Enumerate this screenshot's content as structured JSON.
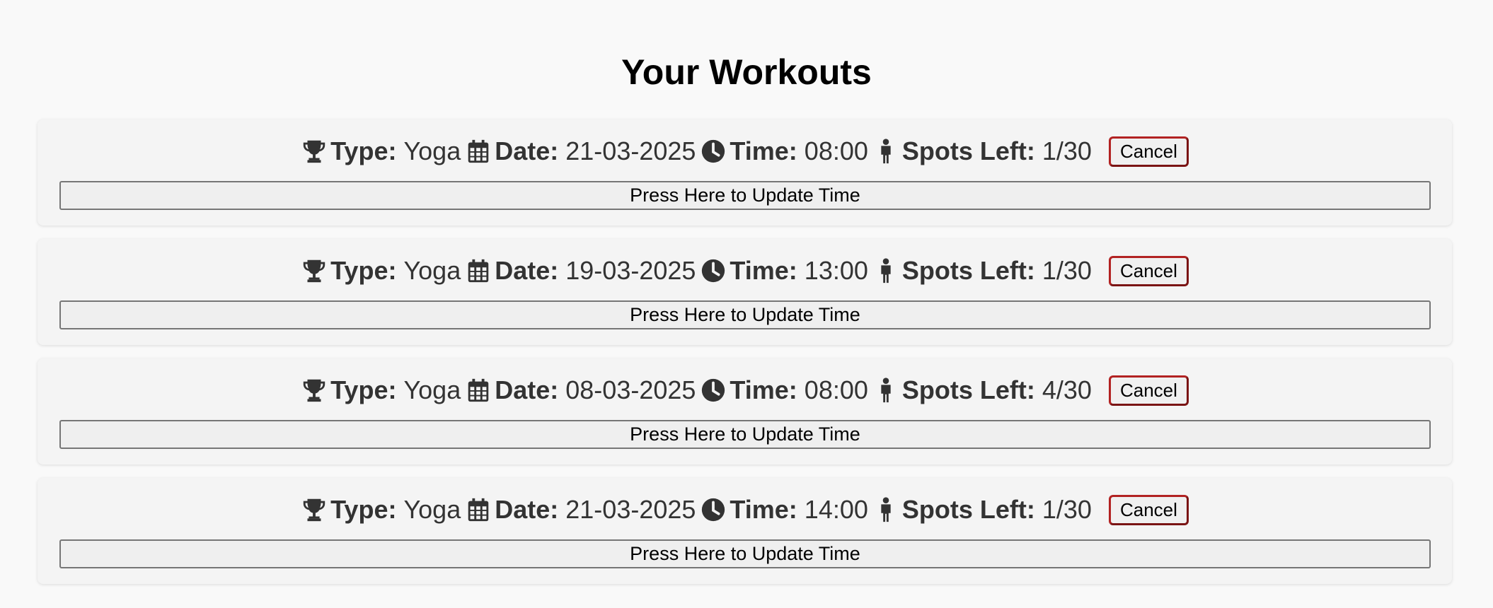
{
  "page": {
    "title": "Your Workouts"
  },
  "labels": {
    "type": "Type:",
    "date": "Date:",
    "time": "Time:",
    "spots": "Spots Left:",
    "cancel": "Cancel",
    "update": "Press Here to Update Time"
  },
  "icons": {
    "type": "trophy-icon",
    "date": "calendar-icon",
    "time": "clock-icon",
    "spots": "person-icon"
  },
  "colors": {
    "background": "#f9f9f9",
    "card": "#f4f4f4",
    "cancel_border": "#b22222",
    "text": "#333333"
  },
  "workouts": [
    {
      "type": "Yoga",
      "date": "21-03-2025",
      "time": "08:00",
      "spots": "1/30"
    },
    {
      "type": "Yoga",
      "date": "19-03-2025",
      "time": "13:00",
      "spots": "1/30"
    },
    {
      "type": "Yoga",
      "date": "08-03-2025",
      "time": "08:00",
      "spots": "4/30"
    },
    {
      "type": "Yoga",
      "date": "21-03-2025",
      "time": "14:00",
      "spots": "1/30"
    }
  ]
}
